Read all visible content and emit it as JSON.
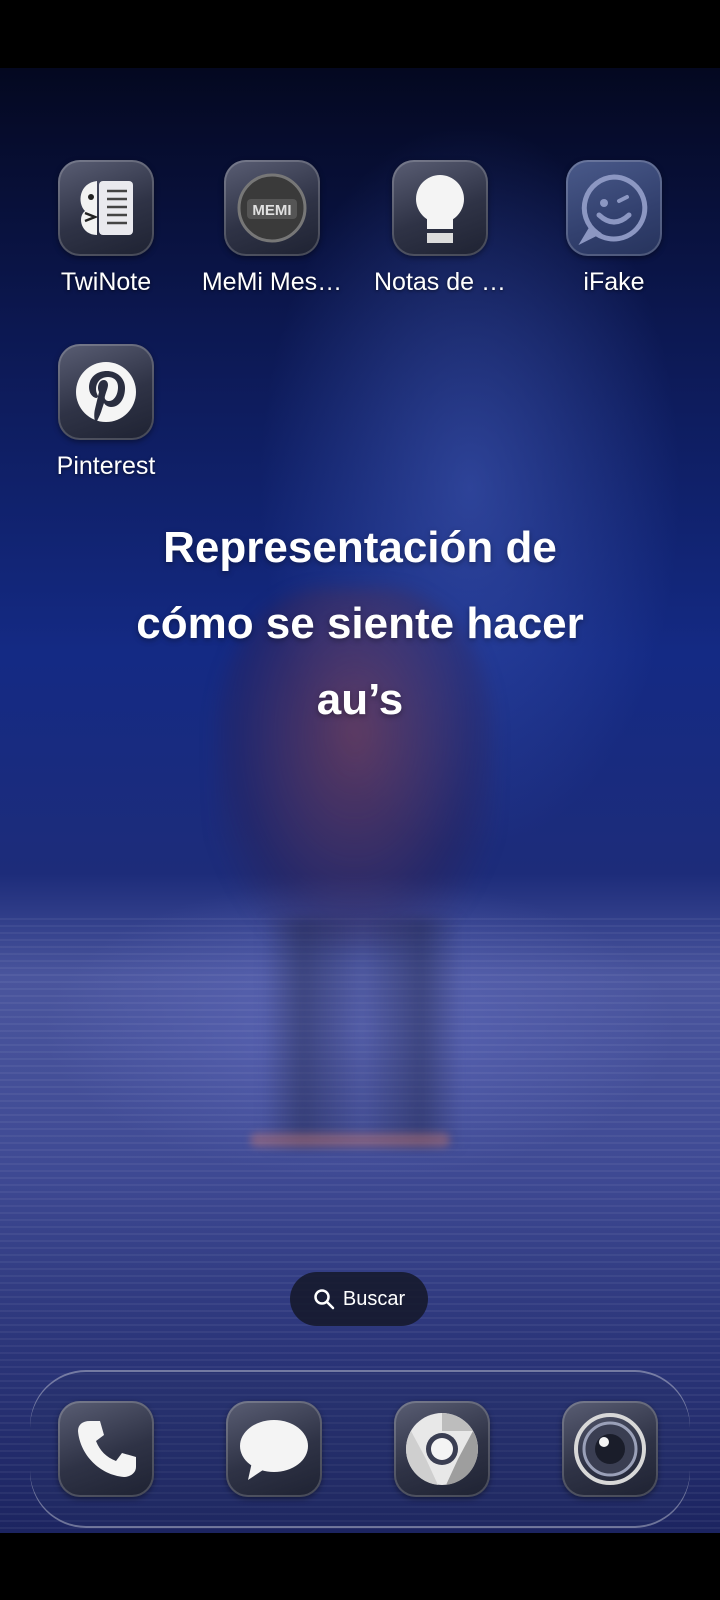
{
  "home": {
    "apps": [
      {
        "label": "TwiNote",
        "icon": "twinote-icon"
      },
      {
        "label": "MeMi Mes…",
        "icon": "memi-icon",
        "badge_text": "MEMI"
      },
      {
        "label": "Notas de …",
        "icon": "lightbulb-icon"
      },
      {
        "label": "iFake",
        "icon": "ifake-icon"
      },
      {
        "label": "Pinterest",
        "icon": "pinterest-icon"
      }
    ],
    "caption_lines": [
      "Representación de",
      "cómo se siente hacer",
      "au’s"
    ]
  },
  "search": {
    "label": "Buscar",
    "icon": "search-icon"
  },
  "dock": {
    "apps": [
      {
        "name": "Teléfono",
        "icon": "phone-icon"
      },
      {
        "name": "Mensajes",
        "icon": "messages-icon"
      },
      {
        "name": "Chrome",
        "icon": "chrome-icon"
      },
      {
        "name": "Cámara",
        "icon": "camera-icon"
      }
    ]
  },
  "colors": {
    "accent": "#1d2c7a",
    "icon_bg": "#2f3346",
    "text": "#ffffff"
  }
}
